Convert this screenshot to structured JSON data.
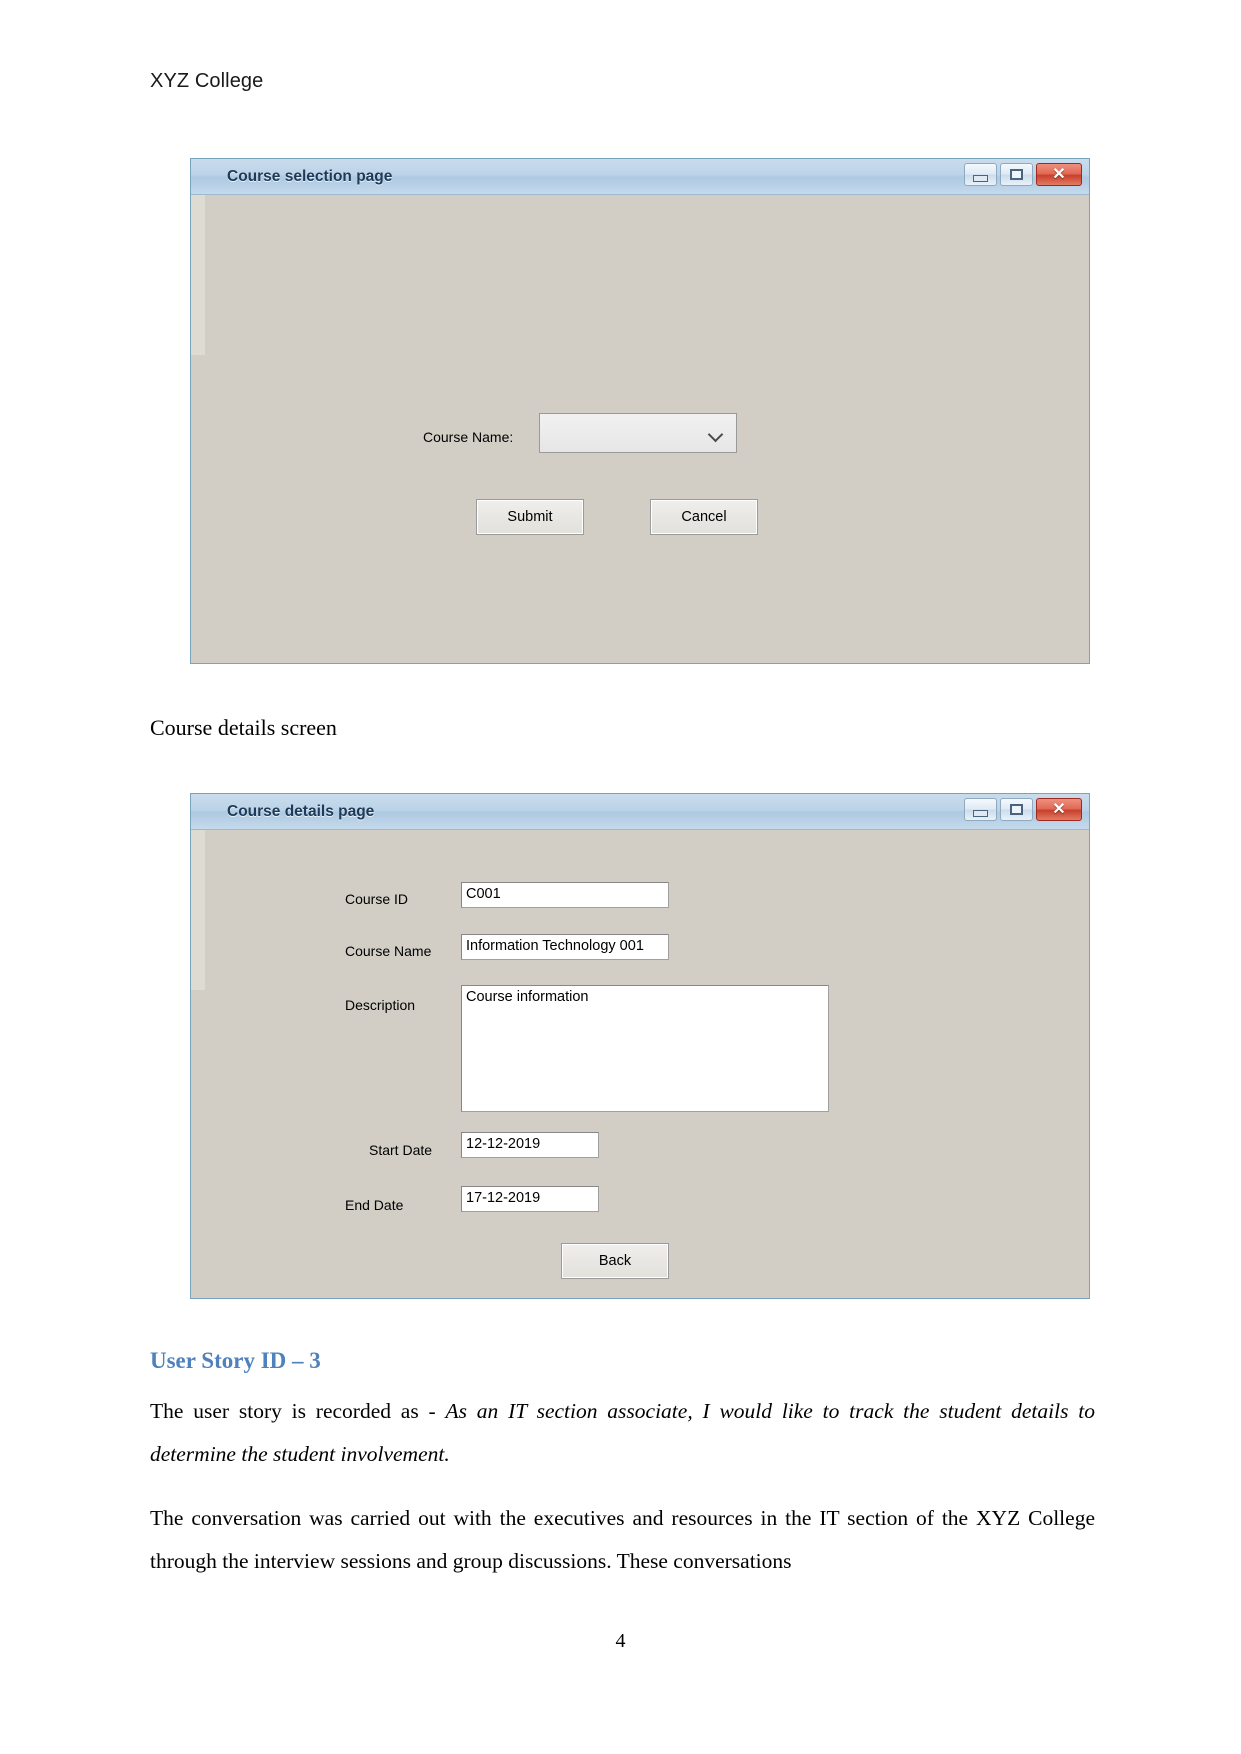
{
  "document": {
    "header": "XYZ College",
    "page_number": "4",
    "caption_course_details": "Course details screen",
    "section_heading": "User Story ID – 3",
    "paragraph1_prefix": "The user story is recorded as - ",
    "paragraph1_italic": "As an IT section associate, I would like to track the student details to determine the student involvement.",
    "paragraph2": "The conversation was carried out with the executives and resources in the IT section of the XYZ College through the interview sessions and group discussions. These conversations"
  },
  "colors": {
    "heading_blue": "#4f81bd",
    "titlebar_blue": "#aec9e2",
    "close_red": "#c8402c",
    "form_background": "#d2cec6"
  },
  "window_course_selection": {
    "title": "Course selection page",
    "controls": {
      "minimize": "minimize",
      "maximize": "maximize",
      "close": "✕"
    },
    "fields": {
      "course_name_label": "Course Name:",
      "course_name_value": "",
      "course_name_placeholder": ""
    },
    "buttons": {
      "submit": "Submit",
      "cancel": "Cancel"
    }
  },
  "window_course_details": {
    "title": "Course details page",
    "controls": {
      "minimize": "minimize",
      "maximize": "maximize",
      "close": "✕"
    },
    "fields": {
      "course_id_label": "Course ID",
      "course_id_value": "C001",
      "course_name_label": "Course Name",
      "course_name_value": "Information Technology 001",
      "description_label": "Description",
      "description_value": "Course information",
      "start_date_label": "Start Date",
      "start_date_value": "12-12-2019",
      "end_date_label": "End Date",
      "end_date_value": "17-12-2019"
    },
    "buttons": {
      "back": "Back"
    }
  }
}
